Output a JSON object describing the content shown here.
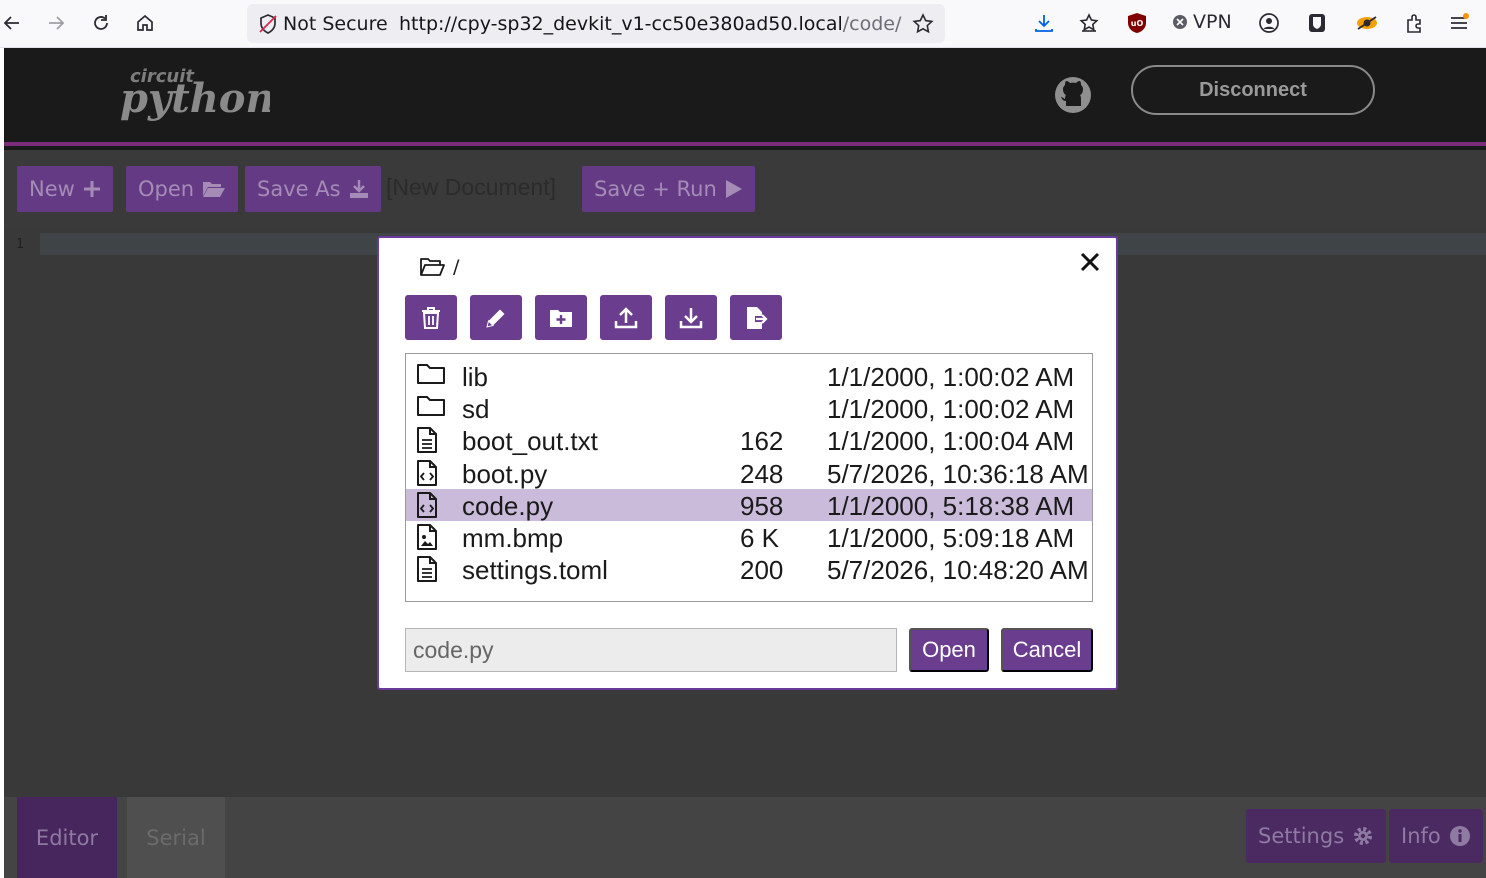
{
  "browser": {
    "security_label": "Not Secure",
    "url_host": "http://cpy-sp32_devkit_v1-cc50e380ad50.local",
    "url_path": "/code/",
    "vpn_label": "VPN"
  },
  "header": {
    "logo_small": "circuit",
    "logo_large": "python",
    "disconnect_label": "Disconnect"
  },
  "filebar": {
    "new_label": "New",
    "open_label": "Open",
    "save_as_label": "Save As",
    "document_name": "[New Document]",
    "save_run_label": "Save + Run"
  },
  "editor": {
    "line_number": "1"
  },
  "bottom": {
    "tab_editor": "Editor",
    "tab_serial": "Serial",
    "settings_label": "Settings",
    "info_label": "Info"
  },
  "dialog": {
    "path": "/",
    "files": [
      {
        "name": "lib",
        "size": "",
        "modified": "1/1/2000, 1:00:02 AM",
        "icon": "folder-icon"
      },
      {
        "name": "sd",
        "size": "",
        "modified": "1/1/2000, 1:00:02 AM",
        "icon": "folder-icon"
      },
      {
        "name": "boot_out.txt",
        "size": "162",
        "modified": "1/1/2000, 1:00:04 AM",
        "icon": "text-file-icon"
      },
      {
        "name": "boot.py",
        "size": "248",
        "modified": "5/7/2026, 10:36:18 AM",
        "icon": "code-file-icon"
      },
      {
        "name": "code.py",
        "size": "958",
        "modified": "1/1/2000, 5:18:38 AM",
        "icon": "code-file-icon",
        "selected": true
      },
      {
        "name": "mm.bmp",
        "size": "6 K",
        "modified": "1/1/2000, 5:09:18 AM",
        "icon": "image-file-icon"
      },
      {
        "name": "settings.toml",
        "size": "200",
        "modified": "5/7/2026, 10:48:20 AM",
        "icon": "text-file-icon"
      }
    ],
    "filename_value": "code.py",
    "open_label": "Open",
    "cancel_label": "Cancel"
  },
  "colors": {
    "accent": "#6a3d8f",
    "selected_row": "#c9bbd9",
    "header_border": "#7a2e7a"
  }
}
